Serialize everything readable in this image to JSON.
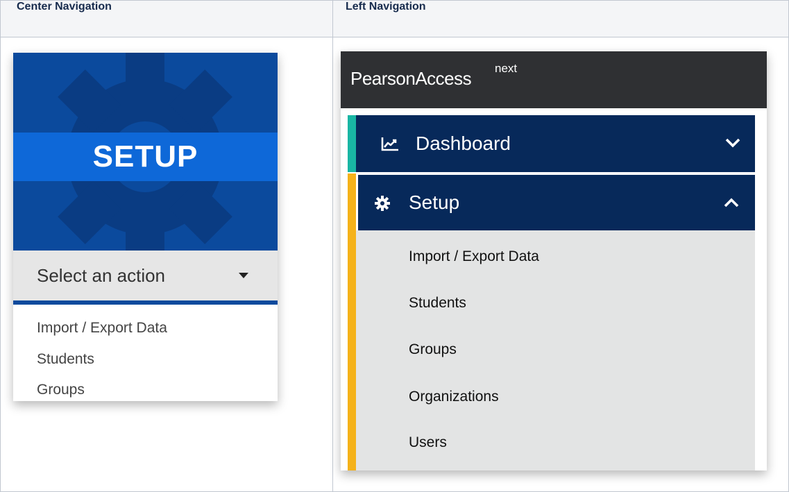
{
  "table": {
    "headers": [
      "Center Navigation",
      "Left Navigation"
    ]
  },
  "center_nav": {
    "tile_title": "SETUP",
    "select_placeholder": "Select an action",
    "actions": [
      "Import / Export Data",
      "Students",
      "Groups"
    ]
  },
  "left_nav": {
    "brand": "PearsonAccess",
    "brand_superscript": "next",
    "dashboard_label": "Dashboard",
    "setup_label": "Setup",
    "setup_items": [
      "Import / Export Data",
      "Students",
      "Groups",
      "Organizations",
      "Users"
    ]
  },
  "colors": {
    "tile_blue": "#0b4a9d",
    "band_blue": "#0e68d8",
    "nav_navy": "#07295a",
    "dashboard_accent": "#19b6a4",
    "setup_accent": "#f5b21a",
    "brand_bar": "#2f3033"
  },
  "icons": {
    "tile": "gear-icon",
    "select": "caret-down-icon",
    "dashboard": "line-chart-icon",
    "setup": "gear-icon",
    "dashboard_toggle": "chevron-down-icon",
    "setup_toggle": "chevron-up-icon"
  }
}
